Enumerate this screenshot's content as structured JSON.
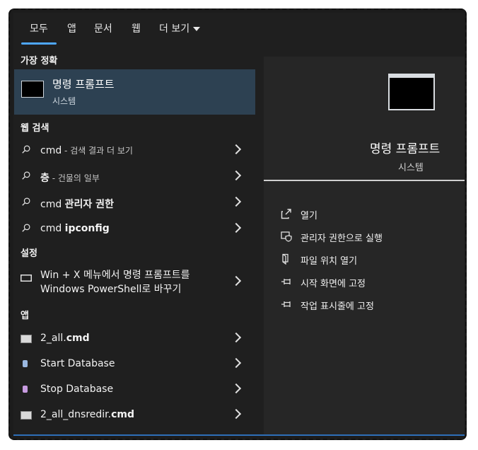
{
  "tabs": [
    {
      "label": "모두"
    },
    {
      "label": "앱"
    },
    {
      "label": "문서"
    },
    {
      "label": "웹"
    },
    {
      "label": "더 보기"
    }
  ],
  "sections": {
    "best_match": "가장 정확",
    "web_search": "웹 검색",
    "settings": "설정",
    "apps": "앱"
  },
  "best_match": {
    "title": "명령 프롬프트",
    "subtitle": "시스템"
  },
  "web_results": [
    {
      "main": "cmd",
      "rest": " - 검색 결과 더 보기"
    },
    {
      "main": "층",
      "rest": " - 건물의 일부"
    },
    {
      "main": "cmd ",
      "rest": "관리자 권한"
    },
    {
      "main": "cmd ",
      "rest": "ipconfig"
    }
  ],
  "settings_item": {
    "line1": "Win + X 메뉴에서 명령 프롬프트를",
    "line2": "Windows PowerShell로 바꾸기"
  },
  "apps": [
    {
      "pre": "2_all.",
      "bold": "cmd"
    },
    {
      "pre": "Start Database",
      "bold": ""
    },
    {
      "pre": "Stop Database",
      "bold": ""
    },
    {
      "pre": "2_all_dnsredir.",
      "bold": "cmd"
    }
  ],
  "detail": {
    "title": "명령 프롬프트",
    "subtitle": "시스템",
    "actions": [
      {
        "label": "열기",
        "icon": "open-icon"
      },
      {
        "label": "관리자 권한으로 실행",
        "icon": "shield-icon"
      },
      {
        "label": "파일 위치 열기",
        "icon": "folder-icon"
      },
      {
        "label": "시작 화면에 고정",
        "icon": "pin-icon"
      },
      {
        "label": "작업 표시줄에 고정",
        "icon": "pin-icon"
      }
    ]
  },
  "colors": {
    "accent": "#4ea7ff",
    "selected": "#2d4152",
    "panel": "#1f1f1f",
    "detail_panel": "#262626"
  }
}
